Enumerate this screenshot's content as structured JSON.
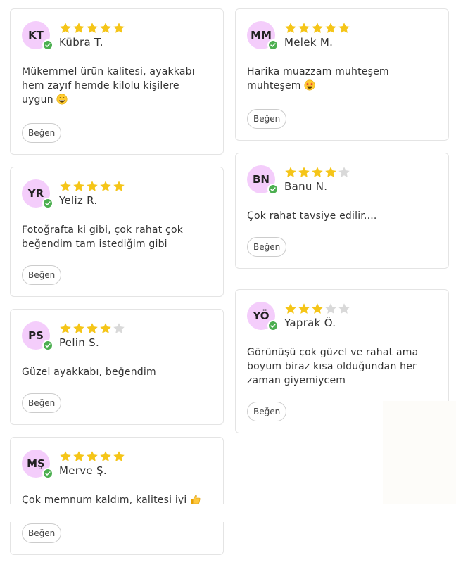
{
  "colors": {
    "star_filled": "#f5c518",
    "star_empty": "#d9d9d9",
    "avatar_bg": "#f4cdfb",
    "verified": "#4caf50"
  },
  "reviews": [
    {
      "initials": "KT",
      "name": "Kübra T.",
      "rating": 5,
      "text": "Mükemmel ürün kalitesi, ayakkabı hem zayıf hemde kilolu kişilere uygun",
      "emoji": "grinning-sweat-emoji",
      "like_label": "Beğen"
    },
    {
      "initials": "YR",
      "name": "Yeliz R.",
      "rating": 5,
      "text": "Fotoğrafta ki gibi, çok rahat çok beğendim tam istediğim gibi",
      "like_label": "Beğen"
    },
    {
      "initials": "PS",
      "name": "Pelin S.",
      "rating": 4,
      "text": "Güzel ayakkabı, beğendim",
      "like_label": "Beğen"
    },
    {
      "initials": "MŞ",
      "name": "Merve Ş.",
      "rating": 5,
      "text": "Çok memnum kaldım, kalitesi iyi",
      "emoji": "thumbs-up-emoji",
      "like_label": "Beğen"
    },
    {
      "initials": "MM",
      "name": "Melek M.",
      "rating": 5,
      "text": "Harika muazzam muhteşem muhteşem",
      "emoji": "star-struck-emoji",
      "like_label": "Beğen"
    },
    {
      "initials": "BN",
      "name": "Banu N.",
      "rating": 4,
      "text": "Çok rahat tavsiye edilir....",
      "like_label": "Beğen"
    },
    {
      "initials": "YÖ",
      "name": "Yaprak Ö.",
      "rating": 3,
      "text": "Görünüşü çok güzel ve rahat ama boyum biraz kısa olduğundan her zaman giyemiycem",
      "like_label": "Beğen"
    }
  ]
}
